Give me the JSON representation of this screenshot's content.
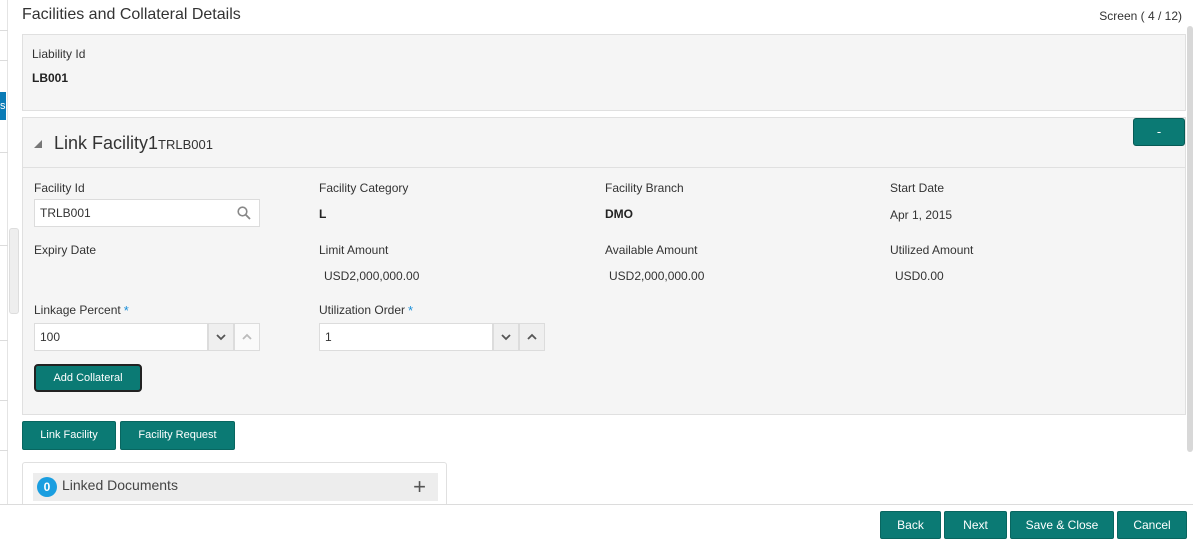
{
  "header": {
    "title": "Facilities and Collateral Details",
    "screen": "Screen ( 4 / 12)"
  },
  "rail": {
    "tab_label": "s"
  },
  "liability": {
    "label": "Liability Id",
    "value": "LB001"
  },
  "facility": {
    "title": "Link Facility1",
    "subtitle": "TRLB001",
    "collapse_label": "-",
    "facility_id_label": "Facility Id",
    "facility_id_value": "TRLB001",
    "category_label": "Facility Category",
    "category_value": "L",
    "branch_label": "Facility Branch",
    "branch_value": "DMO",
    "start_date_label": "Start Date",
    "start_date_value": "Apr 1, 2015",
    "expiry_label": "Expiry Date",
    "limit_label": "Limit Amount",
    "limit_value": "USD2,000,000.00",
    "available_label": "Available Amount",
    "available_value": "USD2,000,000.00",
    "utilized_label": "Utilized Amount",
    "utilized_value": "USD0.00",
    "linkage_label": "Linkage Percent",
    "linkage_value": "100",
    "utilization_label": "Utilization Order",
    "utilization_value": "1",
    "required_mark": "*",
    "add_collateral_label": "Add Collateral"
  },
  "actions": {
    "link_facility": "Link Facility",
    "facility_request": "Facility Request"
  },
  "documents": {
    "count": "0",
    "label": "Linked Documents",
    "add_symbol": "+"
  },
  "footer": {
    "back": "Back",
    "next": "Next",
    "save_close": "Save & Close",
    "cancel": "Cancel"
  },
  "colors": {
    "accent": "#0b7a74",
    "badge": "#1a9ee0",
    "rail_tab": "#0a7bb6"
  }
}
